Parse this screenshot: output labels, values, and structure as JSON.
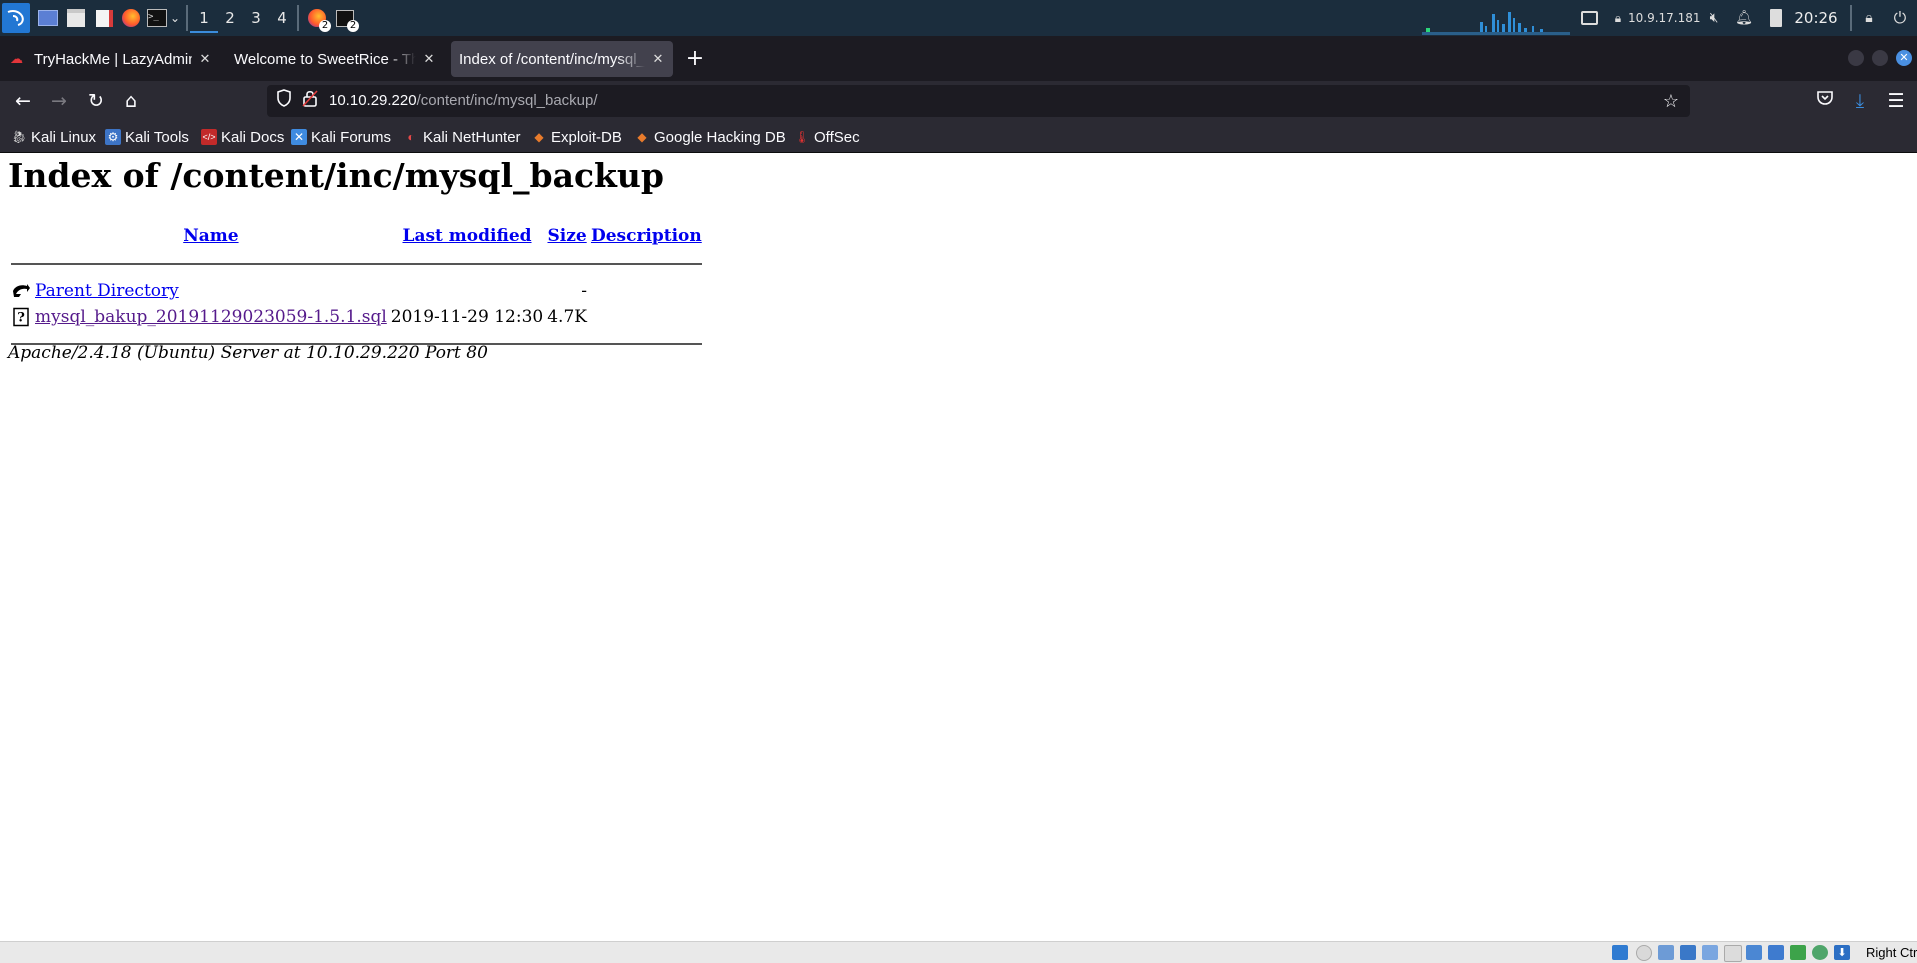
{
  "panel": {
    "workspaces": [
      "1",
      "2",
      "3",
      "4"
    ],
    "active_workspace": "1",
    "badge_firefox": "2",
    "badge_terminal": "2",
    "ip": "10.9.17.181",
    "time": "20:26"
  },
  "tabs": [
    {
      "label": "TryHackMe | LazyAdmin",
      "icon": "tryhackme-icon"
    },
    {
      "label": "Welcome to SweetRice - Thank you for install SweetRice",
      "icon": ""
    },
    {
      "label": "Index of /content/inc/mysql_backup/",
      "icon": ""
    }
  ],
  "url": {
    "host": "10.10.29.220",
    "path": "/content/inc/mysql_backup/"
  },
  "bookmarks": [
    "Kali Linux",
    "Kali Tools",
    "Kali Docs",
    "Kali Forums",
    "Kali NetHunter",
    "Exploit-DB",
    "Google Hacking DB",
    "OffSec"
  ],
  "page": {
    "title": "Index of /content/inc/mysql_backup",
    "columns": [
      "Name",
      "Last modified",
      "Size",
      "Description"
    ],
    "rows": [
      {
        "name": "Parent Directory",
        "modified": "",
        "size": "-",
        "description": ""
      },
      {
        "name": "mysql_bakup_20191129023059-1.5.1.sql",
        "modified": "2019-11-29 12:30",
        "size": "4.7K",
        "description": ""
      }
    ],
    "footer": "Apache/2.4.18 (Ubuntu) Server at 10.10.29.220 Port 80"
  },
  "vbox": {
    "host_key": "Right Ctrl"
  },
  "colors": {
    "panel_bg": "#1b2d3d",
    "tabbar_bg": "#1c1b22",
    "toolbar_bg": "#2b2a33",
    "link": "#0000ee",
    "visited_link": "#551a8b",
    "accent": "#3b8cdc"
  }
}
